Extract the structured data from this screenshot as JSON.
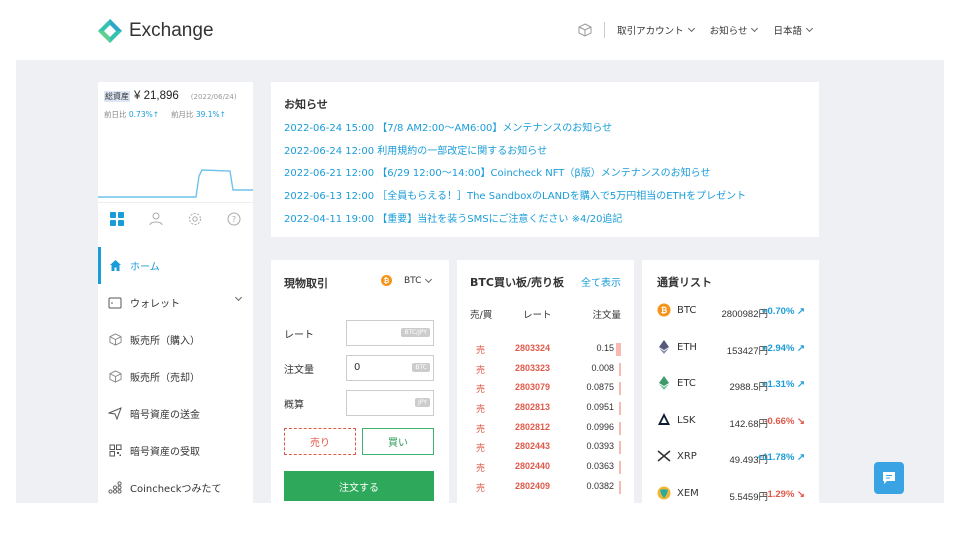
{
  "header": {
    "logo_text": "Exchange",
    "nav": [
      {
        "label": "取引アカウント"
      },
      {
        "label": "お知らせ"
      },
      {
        "label": "日本語"
      }
    ]
  },
  "sidebar": {
    "asset_label": "総資産",
    "asset_value": "¥ 21,896",
    "asset_date": "(2022/06/24)",
    "day_label": "前日比",
    "day_change": "0.73%↑",
    "month_label": "前月比",
    "month_change": "39.1%↑",
    "menu": [
      {
        "label": "ホーム",
        "icon": "home-icon"
      },
      {
        "label": "ウォレット",
        "icon": "wallet-icon"
      },
      {
        "label": "販売所（購入）",
        "icon": "cube-icon"
      },
      {
        "label": "販売所（売却）",
        "icon": "cube-icon"
      },
      {
        "label": "暗号資産の送金",
        "icon": "send-icon"
      },
      {
        "label": "暗号資産の受取",
        "icon": "qr-code-icon"
      },
      {
        "label": "Coincheckつみたて",
        "icon": "coins-icon"
      }
    ]
  },
  "notices": {
    "title": "お知らせ",
    "items": [
      "2022-06-24 15:00 【7/8 AM2:00〜AM6:00】メンテナンスのお知らせ",
      "2022-06-24 12:00 利用規約の一部改定に関するお知らせ",
      "2022-06-21 12:00 【6/29 12:00〜14:00】Coincheck NFT（β版）メンテナンスのお知らせ",
      "2022-06-13 12:00 ［全員もらえる！］The SandboxのLANDを購入で5万円相当のETHをプレゼント",
      "2022-04-11 19:00 【重要】当社を装うSMSにご注意ください ※4/20追記"
    ]
  },
  "spot": {
    "title": "現物取引",
    "coin": "BTC",
    "rate_label": "レート",
    "rate_unit": "BTC/JPY",
    "qty_label": "注文量",
    "qty_value": "0",
    "qty_unit": "BTC",
    "approx_label": "概算",
    "approx_unit": "JPY",
    "sell_label": "売り",
    "buy_label": "買い",
    "order_label": "注文する"
  },
  "book": {
    "title": "BTC買い板/売り板",
    "show_all": "全て表示",
    "col_side": "売/買",
    "col_rate": "レート",
    "col_qty": "注文量",
    "rows": [
      {
        "side": "売",
        "rate": "2803324",
        "qty": "0.15",
        "fill": 0.38
      },
      {
        "side": "売",
        "rate": "2803323",
        "qty": "0.008",
        "fill": 0.04
      },
      {
        "side": "売",
        "rate": "2803079",
        "qty": "0.0875",
        "fill": 0.1
      },
      {
        "side": "売",
        "rate": "2802813",
        "qty": "0.0951",
        "fill": 0.1
      },
      {
        "side": "売",
        "rate": "2802812",
        "qty": "0.0996",
        "fill": 0.12
      },
      {
        "side": "売",
        "rate": "2802443",
        "qty": "0.0393",
        "fill": 0.05
      },
      {
        "side": "売",
        "rate": "2802440",
        "qty": "0.0363",
        "fill": 0.05
      },
      {
        "side": "売",
        "rate": "2802409",
        "qty": "0.0382",
        "fill": 0.05
      }
    ]
  },
  "currency": {
    "title": "通貨リスト",
    "rows": [
      {
        "symbol": "BTC",
        "price": "2800982円",
        "change": "+0.70% ↗",
        "dir": "pos",
        "icon": "btc-icon"
      },
      {
        "symbol": "ETH",
        "price": "153427円",
        "change": "+2.94% ↗",
        "dir": "pos",
        "icon": "eth-icon"
      },
      {
        "symbol": "ETC",
        "price": "2988.5円",
        "change": "+1.31% ↗",
        "dir": "pos",
        "icon": "etc-icon"
      },
      {
        "symbol": "LSK",
        "price": "142.68円",
        "change": "-0.66% ↘",
        "dir": "neg",
        "icon": "lsk-icon"
      },
      {
        "symbol": "XRP",
        "price": "49.493円",
        "change": "+11.78% ↗",
        "dir": "pos",
        "icon": "xrp-icon"
      },
      {
        "symbol": "XEM",
        "price": "5.5459円",
        "change": "-1.29% ↘",
        "dir": "neg",
        "icon": "xem-icon"
      }
    ]
  },
  "colors": {
    "accent_blue": "#1a9cd8",
    "sell_red": "#e05a4a",
    "buy_green": "#2ea85a"
  }
}
